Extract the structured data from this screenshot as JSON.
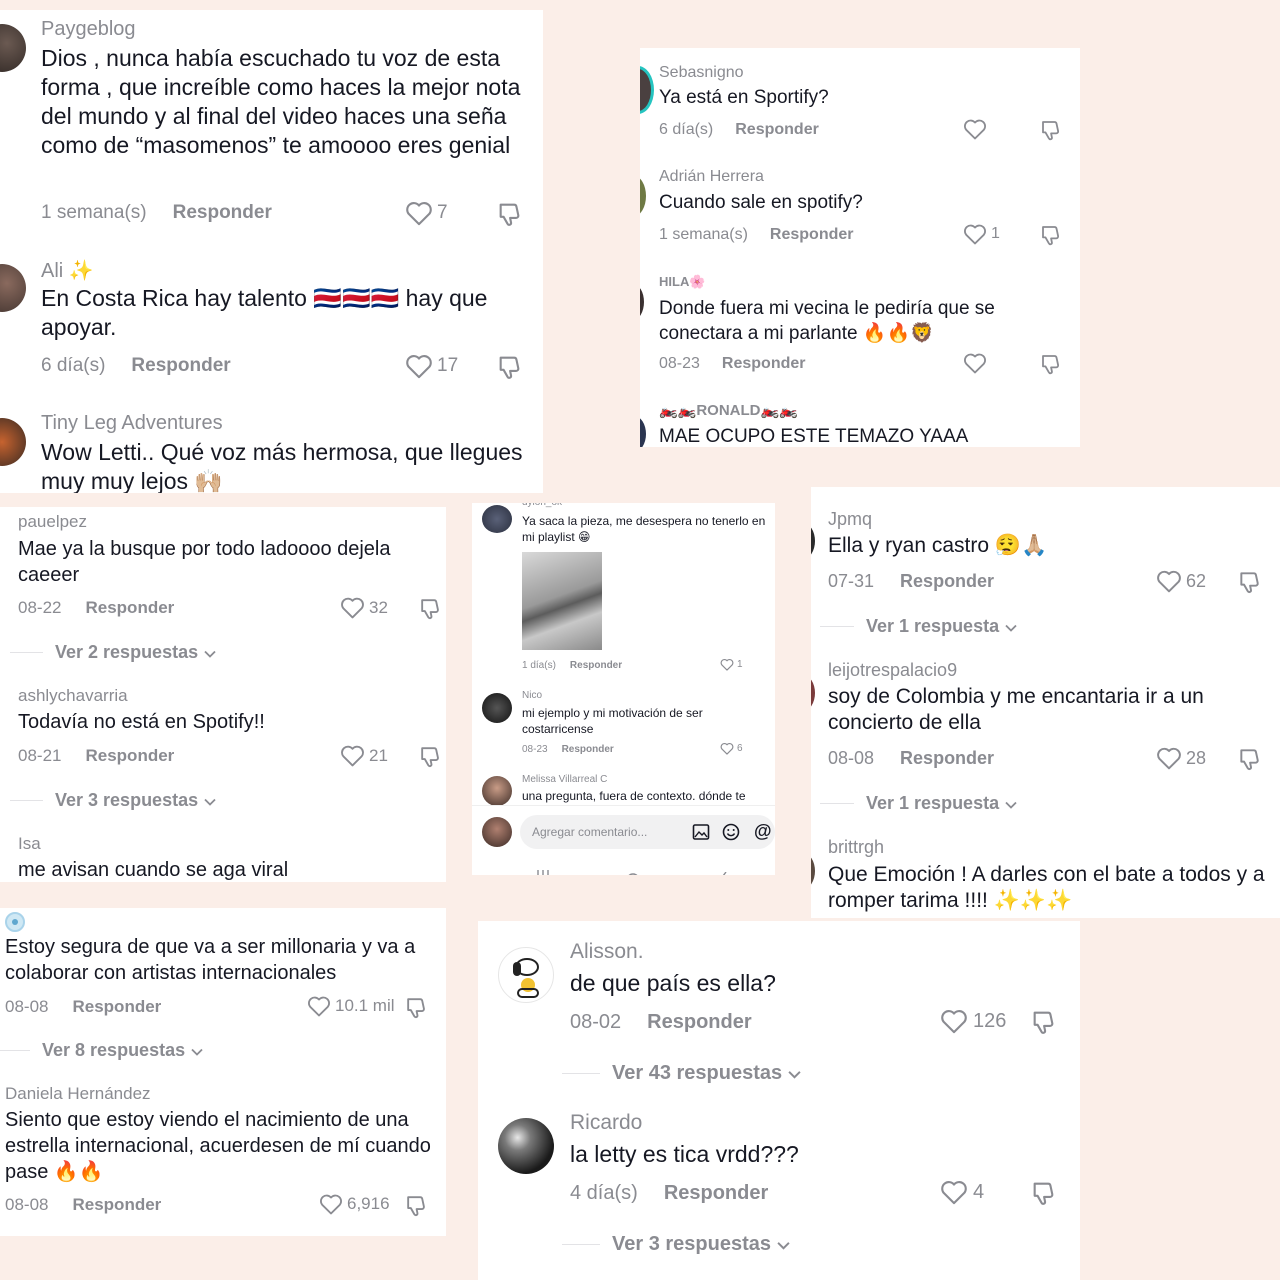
{
  "p1": [
    {
      "user": "Paygeblog",
      "text": "Dios , nunca había escuchado tu voz de esta forma , que increíble como haces la mejor nota del mundo y al final del video haces una seña como de “masomenos” te amoooo eres genial",
      "time": "1 semana(s)",
      "reply": "Responder",
      "likes": "7"
    },
    {
      "user": "Ali ✨",
      "text": "En Costa Rica hay talento 🇨🇷🇨🇷🇨🇷 hay que apoyar.",
      "time": "6 día(s)",
      "reply": "Responder",
      "likes": "17"
    },
    {
      "user": "Tiny Leg Adventures",
      "text": "Wow Letti.. Qué voz más hermosa, que llegues muy muy lejos 🙌🏼"
    }
  ],
  "p2": [
    {
      "user": "Sebasnigno",
      "text": "Ya está en Sportify?",
      "time": "6 día(s)",
      "reply": "Responder"
    },
    {
      "user": "Adrián Herrera",
      "text": "Cuando sale en spotify?",
      "time": "1 semana(s)",
      "reply": "Responder",
      "likes": "1"
    },
    {
      "user": "HILA🌸",
      "text": "Donde fuera mi vecina le pediría que se conectara a mi parlante 🔥🔥🦁",
      "time": "08-23",
      "reply": "Responder"
    },
    {
      "user": "🏍️🏍️RONALD🏍️🏍️",
      "text": "MAE OCUPO ESTE TEMAZO YAAA"
    }
  ],
  "p3": [
    {
      "user": "pauelpez",
      "text": "Mae ya la busque por todo ladoooo dejela caeeer",
      "time": "08-22",
      "reply": "Responder",
      "likes": "32",
      "more": "Ver 2 respuestas"
    },
    {
      "user": "ashlychavarria",
      "text": "Todavía no está en Spotify!!",
      "time": "08-21",
      "reply": "Responder",
      "likes": "21",
      "more": "Ver 3 respuestas"
    },
    {
      "user": "Isa",
      "text": "me avisan cuando se aga viral"
    }
  ],
  "p4": {
    "items": [
      {
        "user": "dylon_ok",
        "text": "Ya saca la pieza, me desespera no tenerlo en mi playlist 😁",
        "time": "1 día(s)",
        "reply": "Responder",
        "likes": "1"
      },
      {
        "user": "Nico",
        "text": "mi ejemplo y mi motivación de ser costarricense",
        "time": "08-23",
        "reply": "Responder",
        "likes": "6"
      },
      {
        "user": "Melissa Villarreal C",
        "text": "una pregunta, fuera de contexto. dónde te"
      }
    ],
    "input_placeholder": "Agregar comentario...",
    "mention": "@"
  },
  "p5": [
    {
      "user": "Jpmq",
      "text": "Ella y ryan castro 😮‍💨🙏🏼",
      "time": "07-31",
      "reply": "Responder",
      "likes": "62",
      "more": "Ver 1 respuesta"
    },
    {
      "user": "leijotrespalacio9",
      "text": "soy de Colombia y me encantaria ir a un concierto de ella",
      "time": "08-08",
      "reply": "Responder",
      "likes": "28",
      "more": "Ver 1 respuesta"
    },
    {
      "user": "brittrgh",
      "text": "Que Emoción ! A darles con el bate a todos y a romper tarima !!!! ✨✨✨"
    }
  ],
  "p6": [
    {
      "text": "Estoy segura de que va a ser millonaria y va a colaborar con artistas internacionales",
      "time": "08-08",
      "reply": "Responder",
      "likes": "10.1 mil",
      "more": "Ver 8 respuestas"
    },
    {
      "user": "Daniela Hernández",
      "text": "Siento que estoy viendo el nacimiento de una estrella internacional, acuerdesen de mí cuando pase 🔥🔥",
      "time": "08-08",
      "reply": "Responder",
      "likes": "6,916"
    }
  ],
  "p7": [
    {
      "user": "Alisson.",
      "text": "de que país es ella?",
      "time": "08-02",
      "reply": "Responder",
      "likes": "126",
      "more": "Ver 43 respuestas"
    },
    {
      "user": "Ricardo",
      "text": "la letty es tica vrdd???",
      "time": "4 día(s)",
      "reply": "Responder",
      "likes": "4",
      "more": "Ver 3 respuestas"
    }
  ],
  "colors": {
    "background": "#fbeee8",
    "text": "#161823",
    "muted": "#8a8b91"
  }
}
